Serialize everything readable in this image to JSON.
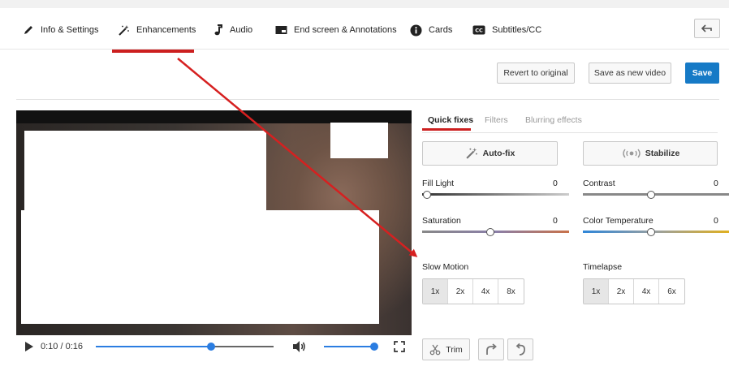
{
  "tabs": [
    {
      "label": "Info & Settings",
      "icon": "pencil-icon"
    },
    {
      "label": "Enhancements",
      "icon": "magic-wand-icon",
      "active": true
    },
    {
      "label": "Audio",
      "icon": "music-note-icon"
    },
    {
      "label": "End screen & Annotations",
      "icon": "end-screen-icon"
    },
    {
      "label": "Cards",
      "icon": "info-icon"
    },
    {
      "label": "Subtitles/CC",
      "icon": "cc-icon"
    }
  ],
  "actions": {
    "revert_label": "Revert to original",
    "save_new_label": "Save as new video",
    "save_label": "Save"
  },
  "player": {
    "time": "0:10 / 0:16",
    "progress": 0.65,
    "volume": 1.0
  },
  "subtabs": [
    {
      "label": "Quick fixes",
      "active": true
    },
    {
      "label": "Filters"
    },
    {
      "label": "Blurring effects"
    }
  ],
  "quick_fixes": {
    "autofix_label": "Auto-fix",
    "stabilize_label": "Stabilize"
  },
  "sliders": {
    "fill_light": {
      "label": "Fill Light",
      "value": "0"
    },
    "contrast": {
      "label": "Contrast",
      "value": "0"
    },
    "saturation": {
      "label": "Saturation",
      "value": "0"
    },
    "color_temperature": {
      "label": "Color Temperature",
      "value": "0"
    }
  },
  "slow_motion": {
    "label": "Slow Motion",
    "options": [
      "1x",
      "2x",
      "4x",
      "8x"
    ],
    "selected": "1x"
  },
  "timelapse": {
    "label": "Timelapse",
    "options": [
      "1x",
      "2x",
      "4x",
      "6x"
    ],
    "selected": "1x"
  },
  "edit": {
    "trim_label": "Trim"
  },
  "colors": {
    "accent_red": "#cc1f1f",
    "primary_blue": "#167ac6",
    "player_blue": "#2b7de1"
  }
}
